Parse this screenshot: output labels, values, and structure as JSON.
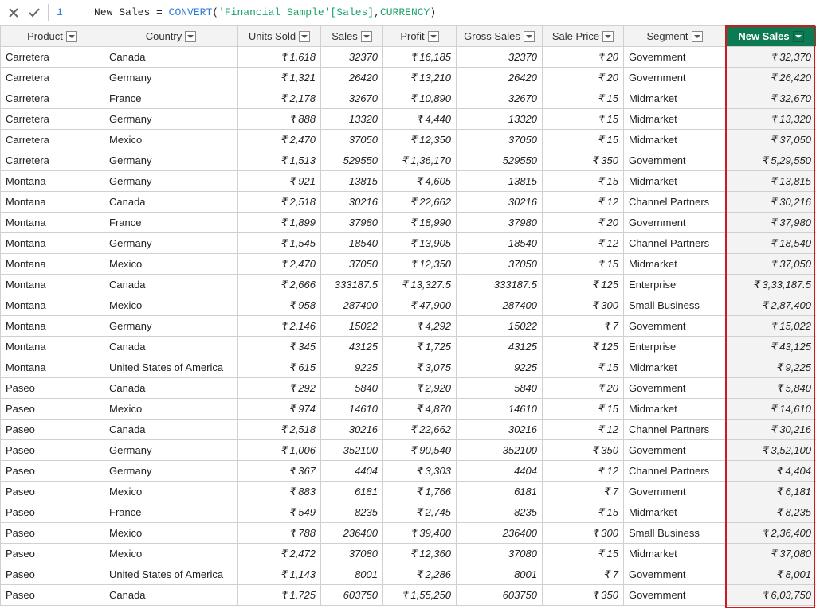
{
  "formula": {
    "linenum": "1",
    "measure_name": "New Sales",
    "equals": " = ",
    "func": "CONVERT",
    "open": "(",
    "ref": "'Financial Sample'[Sales]",
    "comma": ",",
    "arg": "CURRENCY",
    "close": ")"
  },
  "columns": {
    "product": "Product",
    "country": "Country",
    "units": "Units Sold",
    "sales": "Sales",
    "profit": "Profit",
    "gross": "Gross Sales",
    "saleprice": "Sale Price",
    "segment": "Segment",
    "newsales": "New Sales"
  },
  "rows": [
    {
      "product": "Carretera",
      "country": "Canada",
      "units": "₹ 1,618",
      "sales": "32370",
      "profit": "₹ 16,185",
      "gross": "32370",
      "saleprice": "₹ 20",
      "segment": "Government",
      "newsales": "₹ 32,370"
    },
    {
      "product": "Carretera",
      "country": "Germany",
      "units": "₹ 1,321",
      "sales": "26420",
      "profit": "₹ 13,210",
      "gross": "26420",
      "saleprice": "₹ 20",
      "segment": "Government",
      "newsales": "₹ 26,420"
    },
    {
      "product": "Carretera",
      "country": "France",
      "units": "₹ 2,178",
      "sales": "32670",
      "profit": "₹ 10,890",
      "gross": "32670",
      "saleprice": "₹ 15",
      "segment": "Midmarket",
      "newsales": "₹ 32,670"
    },
    {
      "product": "Carretera",
      "country": "Germany",
      "units": "₹ 888",
      "sales": "13320",
      "profit": "₹ 4,440",
      "gross": "13320",
      "saleprice": "₹ 15",
      "segment": "Midmarket",
      "newsales": "₹ 13,320"
    },
    {
      "product": "Carretera",
      "country": "Mexico",
      "units": "₹ 2,470",
      "sales": "37050",
      "profit": "₹ 12,350",
      "gross": "37050",
      "saleprice": "₹ 15",
      "segment": "Midmarket",
      "newsales": "₹ 37,050"
    },
    {
      "product": "Carretera",
      "country": "Germany",
      "units": "₹ 1,513",
      "sales": "529550",
      "profit": "₹ 1,36,170",
      "gross": "529550",
      "saleprice": "₹ 350",
      "segment": "Government",
      "newsales": "₹ 5,29,550"
    },
    {
      "product": "Montana",
      "country": "Germany",
      "units": "₹ 921",
      "sales": "13815",
      "profit": "₹ 4,605",
      "gross": "13815",
      "saleprice": "₹ 15",
      "segment": "Midmarket",
      "newsales": "₹ 13,815"
    },
    {
      "product": "Montana",
      "country": "Canada",
      "units": "₹ 2,518",
      "sales": "30216",
      "profit": "₹ 22,662",
      "gross": "30216",
      "saleprice": "₹ 12",
      "segment": "Channel Partners",
      "newsales": "₹ 30,216"
    },
    {
      "product": "Montana",
      "country": "France",
      "units": "₹ 1,899",
      "sales": "37980",
      "profit": "₹ 18,990",
      "gross": "37980",
      "saleprice": "₹ 20",
      "segment": "Government",
      "newsales": "₹ 37,980"
    },
    {
      "product": "Montana",
      "country": "Germany",
      "units": "₹ 1,545",
      "sales": "18540",
      "profit": "₹ 13,905",
      "gross": "18540",
      "saleprice": "₹ 12",
      "segment": "Channel Partners",
      "newsales": "₹ 18,540"
    },
    {
      "product": "Montana",
      "country": "Mexico",
      "units": "₹ 2,470",
      "sales": "37050",
      "profit": "₹ 12,350",
      "gross": "37050",
      "saleprice": "₹ 15",
      "segment": "Midmarket",
      "newsales": "₹ 37,050"
    },
    {
      "product": "Montana",
      "country": "Canada",
      "units": "₹ 2,666",
      "sales": "333187.5",
      "profit": "₹ 13,327.5",
      "gross": "333187.5",
      "saleprice": "₹ 125",
      "segment": "Enterprise",
      "newsales": "₹ 3,33,187.5"
    },
    {
      "product": "Montana",
      "country": "Mexico",
      "units": "₹ 958",
      "sales": "287400",
      "profit": "₹ 47,900",
      "gross": "287400",
      "saleprice": "₹ 300",
      "segment": "Small Business",
      "newsales": "₹ 2,87,400"
    },
    {
      "product": "Montana",
      "country": "Germany",
      "units": "₹ 2,146",
      "sales": "15022",
      "profit": "₹ 4,292",
      "gross": "15022",
      "saleprice": "₹ 7",
      "segment": "Government",
      "newsales": "₹ 15,022"
    },
    {
      "product": "Montana",
      "country": "Canada",
      "units": "₹ 345",
      "sales": "43125",
      "profit": "₹ 1,725",
      "gross": "43125",
      "saleprice": "₹ 125",
      "segment": "Enterprise",
      "newsales": "₹ 43,125"
    },
    {
      "product": "Montana",
      "country": "United States of America",
      "units": "₹ 615",
      "sales": "9225",
      "profit": "₹ 3,075",
      "gross": "9225",
      "saleprice": "₹ 15",
      "segment": "Midmarket",
      "newsales": "₹ 9,225"
    },
    {
      "product": "Paseo",
      "country": "Canada",
      "units": "₹ 292",
      "sales": "5840",
      "profit": "₹ 2,920",
      "gross": "5840",
      "saleprice": "₹ 20",
      "segment": "Government",
      "newsales": "₹ 5,840"
    },
    {
      "product": "Paseo",
      "country": "Mexico",
      "units": "₹ 974",
      "sales": "14610",
      "profit": "₹ 4,870",
      "gross": "14610",
      "saleprice": "₹ 15",
      "segment": "Midmarket",
      "newsales": "₹ 14,610"
    },
    {
      "product": "Paseo",
      "country": "Canada",
      "units": "₹ 2,518",
      "sales": "30216",
      "profit": "₹ 22,662",
      "gross": "30216",
      "saleprice": "₹ 12",
      "segment": "Channel Partners",
      "newsales": "₹ 30,216"
    },
    {
      "product": "Paseo",
      "country": "Germany",
      "units": "₹ 1,006",
      "sales": "352100",
      "profit": "₹ 90,540",
      "gross": "352100",
      "saleprice": "₹ 350",
      "segment": "Government",
      "newsales": "₹ 3,52,100"
    },
    {
      "product": "Paseo",
      "country": "Germany",
      "units": "₹ 367",
      "sales": "4404",
      "profit": "₹ 3,303",
      "gross": "4404",
      "saleprice": "₹ 12",
      "segment": "Channel Partners",
      "newsales": "₹ 4,404"
    },
    {
      "product": "Paseo",
      "country": "Mexico",
      "units": "₹ 883",
      "sales": "6181",
      "profit": "₹ 1,766",
      "gross": "6181",
      "saleprice": "₹ 7",
      "segment": "Government",
      "newsales": "₹ 6,181"
    },
    {
      "product": "Paseo",
      "country": "France",
      "units": "₹ 549",
      "sales": "8235",
      "profit": "₹ 2,745",
      "gross": "8235",
      "saleprice": "₹ 15",
      "segment": "Midmarket",
      "newsales": "₹ 8,235"
    },
    {
      "product": "Paseo",
      "country": "Mexico",
      "units": "₹ 788",
      "sales": "236400",
      "profit": "₹ 39,400",
      "gross": "236400",
      "saleprice": "₹ 300",
      "segment": "Small Business",
      "newsales": "₹ 2,36,400"
    },
    {
      "product": "Paseo",
      "country": "Mexico",
      "units": "₹ 2,472",
      "sales": "37080",
      "profit": "₹ 12,360",
      "gross": "37080",
      "saleprice": "₹ 15",
      "segment": "Midmarket",
      "newsales": "₹ 37,080"
    },
    {
      "product": "Paseo",
      "country": "United States of America",
      "units": "₹ 1,143",
      "sales": "8001",
      "profit": "₹ 2,286",
      "gross": "8001",
      "saleprice": "₹ 7",
      "segment": "Government",
      "newsales": "₹ 8,001"
    },
    {
      "product": "Paseo",
      "country": "Canada",
      "units": "₹ 1,725",
      "sales": "603750",
      "profit": "₹ 1,55,250",
      "gross": "603750",
      "saleprice": "₹ 350",
      "segment": "Government",
      "newsales": "₹ 6,03,750"
    }
  ]
}
